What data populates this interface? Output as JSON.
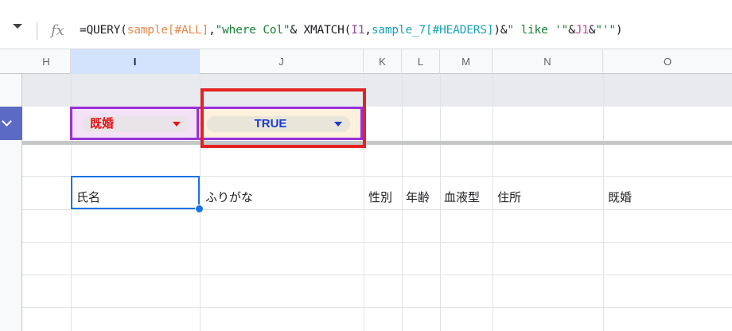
{
  "formula_bar": {
    "fx_symbol": "fx",
    "parts": [
      {
        "text": "=QUERY(",
        "kind": "def"
      },
      {
        "text": "sample[#ALL]",
        "kind": "ref1"
      },
      {
        "text": ",",
        "kind": "def"
      },
      {
        "text": "\"where Col\"",
        "kind": "str"
      },
      {
        "text": "& XMATCH(",
        "kind": "def"
      },
      {
        "text": "I1",
        "kind": "ref2"
      },
      {
        "text": ",",
        "kind": "def"
      },
      {
        "text": "sample_7[#HEADERS]",
        "kind": "ref3"
      },
      {
        "text": ")&",
        "kind": "def"
      },
      {
        "text": "\" like '\"",
        "kind": "str"
      },
      {
        "text": "&",
        "kind": "def"
      },
      {
        "text": "J1",
        "kind": "ref4"
      },
      {
        "text": "&",
        "kind": "def"
      },
      {
        "text": "\"'\"",
        "kind": "str"
      },
      {
        "text": ")",
        "kind": "def"
      }
    ]
  },
  "columns": {
    "h": "H",
    "i": "I",
    "j": "J",
    "k": "K",
    "l": "L",
    "m": "M",
    "n": "N",
    "o": "O"
  },
  "selected_column": "I",
  "chips": {
    "i_value": "既婚",
    "j_value": "TRUE"
  },
  "header_row": {
    "i": "氏名",
    "j": "ふりがな",
    "k": "性別",
    "l": "年齢",
    "m": "血液型",
    "n": "住所",
    "o": "既婚"
  },
  "colors": {
    "chip_i_text": "#e01515",
    "chip_j_text": "#1a3cd1",
    "selection_outline": "#9b30d9",
    "highlight_box": "#e32222",
    "active_cell": "#1a73e8"
  }
}
